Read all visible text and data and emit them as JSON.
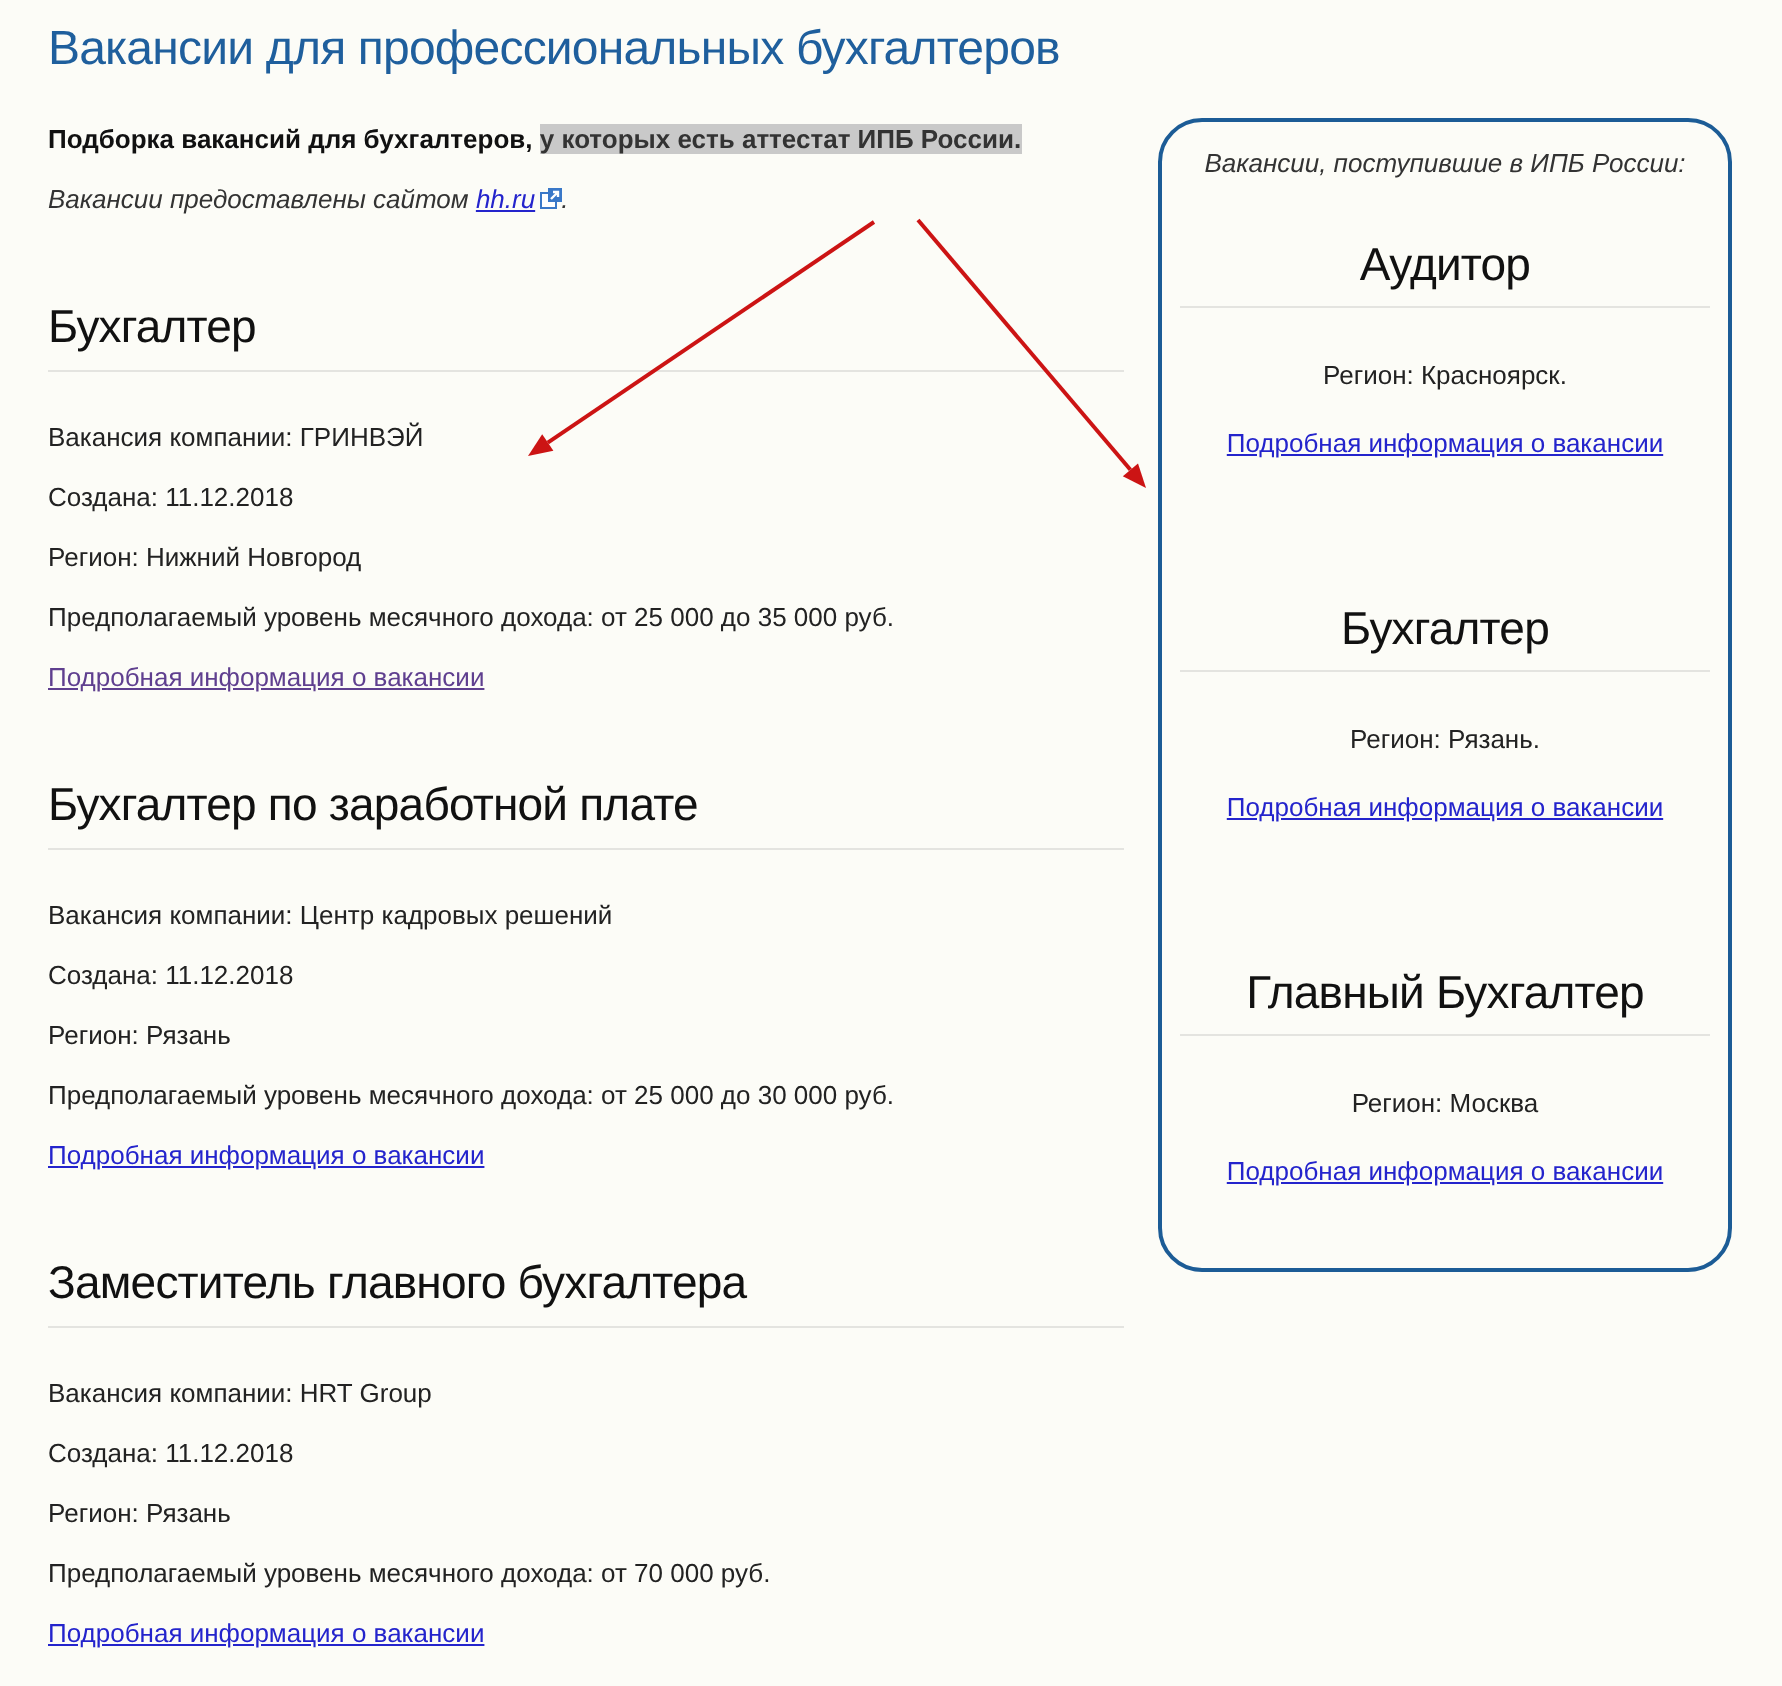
{
  "page": {
    "title": "Вакансии для профессиональных бухгалтеров",
    "intro": {
      "text": "Подборка вакансий для бухгалтеров,",
      "highlight": "у которых есть аттестат ИПБ России."
    },
    "source_note": {
      "text": "Вакансии предоставлены сайтом",
      "link": "hh.ru",
      "after": "."
    }
  },
  "vacancies": [
    {
      "title": "Бухгалтер",
      "details": [
        "Вакансия компании: ГРИНВЭЙ",
        "Создана: 11.12.2018",
        "Регион: Нижний Новгород",
        "Предполагаемый уровень месячного дохода: от 25 000 до 35 000 руб."
      ],
      "link": {
        "label": "Подробная информация о вакансии",
        "visited": true
      }
    },
    {
      "title": "Бухгалтер по заработной плате",
      "details": [
        "Вакансия компании: Центр кадровых решений",
        "Создана: 11.12.2018",
        "Регион: Рязань",
        "Предполагаемый уровень месячного дохода: от 25 000 до 30 000 руб."
      ],
      "link": {
        "label": "Подробная информация о вакансии",
        "visited": false
      }
    },
    {
      "title": "Заместитель главного бухгалтера",
      "details": [
        "Вакансия компании: HRT Group",
        "Создана: 11.12.2018",
        "Регион: Рязань",
        "Предполагаемый уровень месячного дохода: от 70 000 руб."
      ],
      "link": {
        "label": "Подробная информация о вакансии",
        "visited": false
      }
    }
  ],
  "sidebar": {
    "caption": "Вакансии, поступившие в ИПБ России:",
    "items": [
      {
        "title": "Аудитор",
        "region": "Регион: Красноярск.",
        "link": {
          "label": "Подробная информация о вакансии",
          "visited": false
        }
      },
      {
        "title": "Бухгалтер",
        "region": "Регион: Рязань.",
        "link": {
          "label": "Подробная информация о вакансии",
          "visited": false
        }
      },
      {
        "title": "Главный Бухгалтер",
        "region": "Регион: Москва",
        "link": {
          "label": "Подробная информация о вакансии",
          "visited": false
        }
      }
    ]
  }
}
